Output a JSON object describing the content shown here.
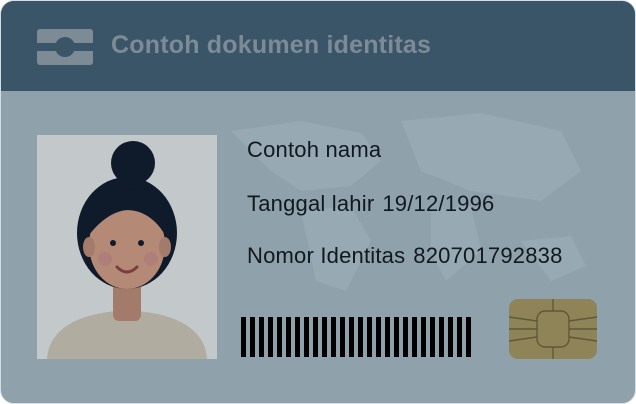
{
  "header": {
    "title": "Contoh dokumen identitas",
    "logo_icon": "id-card-logo-icon"
  },
  "photo": {
    "icon": "woman-avatar-icon"
  },
  "fields": {
    "name": "Contoh nama",
    "birth_label": "Tanggal lahir",
    "birth_value": "19/12/1996",
    "id_label": "Nomor Identitas",
    "id_value": "820701792838"
  },
  "barcode_icon": "barcode-icon",
  "chip_icon": "sim-chip-icon",
  "colors": {
    "header_bg": "#3b5568",
    "card_bg": "#8fa1ab",
    "photo_bg": "#c3c8cb",
    "chip_gold": "#8f8457"
  }
}
